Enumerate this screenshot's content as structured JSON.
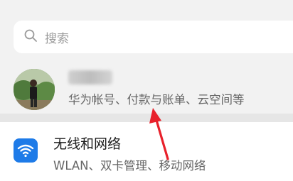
{
  "search": {
    "placeholder": "搜索",
    "icon": "search-icon"
  },
  "account": {
    "subtitle": "华为帐号、付款与账单、云空间等",
    "avatar_icon": "avatar"
  },
  "settings": [
    {
      "title": "无线和网络",
      "subtitle": "WLAN、双卡管理、移动网络",
      "icon": "wifi-icon",
      "icon_color": "#1e7be8"
    }
  ],
  "annotation": {
    "color": "#e8212b",
    "icon": "red-arrow"
  }
}
